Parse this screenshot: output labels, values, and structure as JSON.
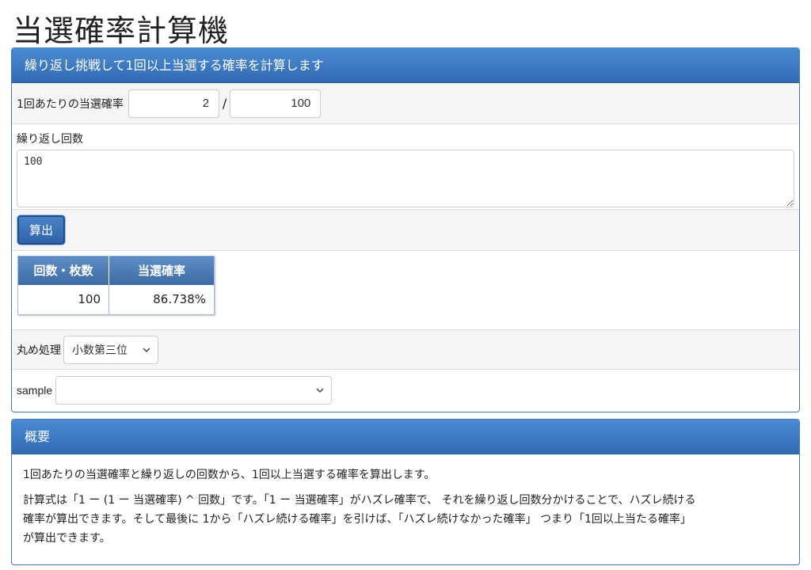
{
  "page_title": "当選確率計算機",
  "calc_panel": {
    "heading": "繰り返し挑戦して1回以上当選する確率を計算します",
    "rate_label": "1回あたりの当選確率",
    "rate_numerator": "2",
    "rate_separator": "/",
    "rate_denominator": "100",
    "repeat_label": "繰り返し回数",
    "repeat_value": "100",
    "calc_button": "算出",
    "result_table": {
      "headers": [
        "回数・枚数",
        "当選確率"
      ],
      "rows": [
        [
          "100",
          "86.738%"
        ]
      ]
    },
    "rounding_label": "丸め処理",
    "rounding_selected": "小数第三位",
    "sample_label": "sample",
    "sample_selected": ""
  },
  "summary_panel": {
    "heading": "概要",
    "paragraph1": "1回あたりの当選確率と繰り返しの回数から、1回以上当選する確率を算出します。",
    "paragraph2_line1": "計算式は「1 ー (1 ー 当選確率) ^ 回数」です。「1 ー 当選確率」がハズレ確率で、 それを繰り返し回数分かけることで、ハズレ続ける",
    "paragraph2_line2": "確率が算出できます。そして最後に 1から「ハズレ続ける確率」を引けば、「ハズレ続けなかった確率」 つまり「1回以上当たる確率」",
    "paragraph2_line3": "が算出できます。"
  },
  "colors": {
    "panel_header_top": "#4a8bd1",
    "panel_header_bottom": "#326ab4",
    "panel_border": "#3f7ac0",
    "table_header": "#3b6aa5",
    "row_alt": "#f5f5f5"
  },
  "icons": {
    "select_arrow": "chevron-down-icon"
  }
}
